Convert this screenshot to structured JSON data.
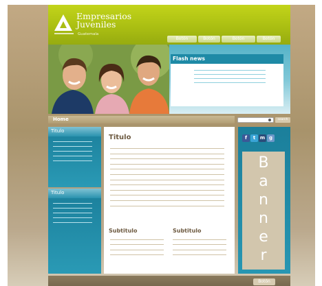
{
  "logo": {
    "title_line1": "Empresarios",
    "title_line2": "Juveniles",
    "subtitle": "Guatemala"
  },
  "nav": {
    "buttons": [
      "Botón",
      "Botón",
      "Botón",
      "Botón"
    ]
  },
  "flash": {
    "title": "Flash news"
  },
  "breadcrumb": {
    "label": "Home"
  },
  "search": {
    "button_label": "search"
  },
  "sidebar": {
    "boxes": [
      {
        "title": "Titulo"
      },
      {
        "title": "Titulo"
      }
    ]
  },
  "main": {
    "title": "Titulo",
    "subtitles": [
      "Subtitulo",
      "Subtitulo"
    ]
  },
  "social": {
    "icons": [
      "facebook-icon",
      "twitter-icon",
      "myspace-icon",
      "google-icon"
    ]
  },
  "banner": {
    "letters": [
      "B",
      "a",
      "n",
      "n",
      "e",
      "r"
    ]
  },
  "footer": {
    "button_label": "Botón"
  },
  "colors": {
    "header_green": "#a9bd12",
    "teal": "#1e8aa6",
    "tan": "#b19d74"
  }
}
